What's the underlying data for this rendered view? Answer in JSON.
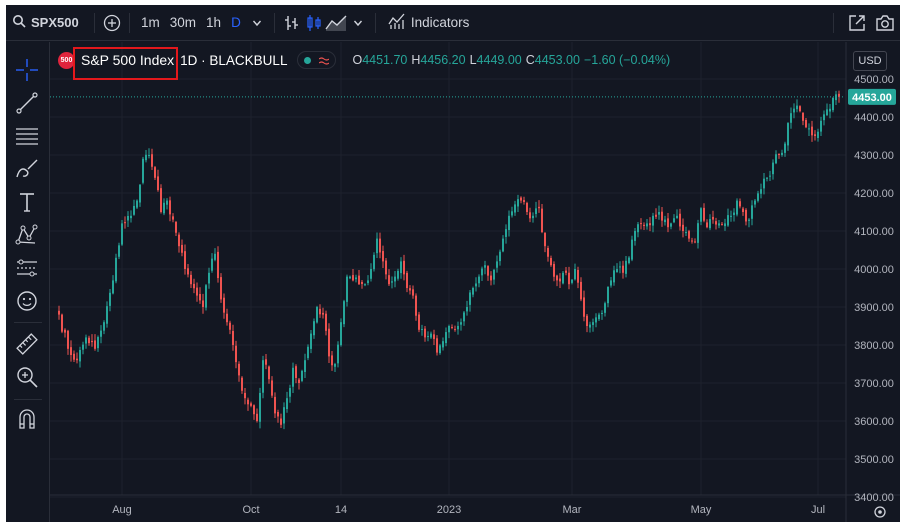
{
  "toolbar": {
    "symbol": "SPX500",
    "intervals": [
      "1m",
      "30m",
      "1h",
      "D"
    ],
    "active_interval": "D",
    "indicators_label": "Indicators",
    "icons": [
      "search-icon",
      "add-compare-icon",
      "chevron-down-icon",
      "bar-style-icon",
      "candlestick-icon",
      "area-chart-icon",
      "indicators-icon",
      "fullscreen-icon",
      "camera-icon"
    ]
  },
  "left_toolbar": {
    "tools": [
      "crosshair-icon",
      "trend-line-icon",
      "fib-lines-icon",
      "brush-icon",
      "text-icon",
      "pattern-icon",
      "forecast-icon",
      "emoji-icon",
      "ruler-icon",
      "zoom-icon",
      "magnet-icon"
    ]
  },
  "legend": {
    "logo_text": "500",
    "symbol_name": "S&P 500 Index",
    "interval_source": "1D · BLACKBULL",
    "o_label": "O",
    "o_value": "4451.70",
    "h_label": "H",
    "h_value": "4456.20",
    "l_label": "L",
    "l_value": "4449.00",
    "c_label": "C",
    "c_value": "4453.00",
    "change": "−1.60 (−0.04%)"
  },
  "price_scale": {
    "currency": "USD",
    "last_price_label": "4453.00"
  },
  "colors": {
    "background": "#131722",
    "up": "#26a69a",
    "down": "#ef5350",
    "text": "#d1d4dc",
    "accent": "#2962ff",
    "highlight": "#e3181c"
  },
  "chart_data": {
    "type": "candlestick",
    "title": "S&P 500 Index",
    "subtitle": "1D · BLACKBULL",
    "ylim": [
      3400,
      4500
    ],
    "y_ticks": [
      4500,
      4400,
      4300,
      4200,
      4100,
      4000,
      3900,
      3800,
      3700,
      3600,
      3500,
      3400
    ],
    "y_tick_labels": [
      "4500.00",
      "4400.00",
      "4300.00",
      "4200.00",
      "4100.00",
      "4000.00",
      "3900.00",
      "3800.00",
      "3700.00",
      "3600.00",
      "3500.00",
      "3400.00"
    ],
    "x_ticks": [
      {
        "label": "Aug",
        "index": 21
      },
      {
        "label": "Oct",
        "index": 64
      },
      {
        "label": "14",
        "index": 94
      },
      {
        "label": "2023",
        "index": 130
      },
      {
        "label": "Mar",
        "index": 171
      },
      {
        "label": "May",
        "index": 214
      },
      {
        "label": "Jul",
        "index": 253
      }
    ],
    "last_price": 4453.0,
    "anchors": [
      [
        0,
        3880
      ],
      [
        3,
        3790
      ],
      [
        6,
        3760
      ],
      [
        9,
        3820
      ],
      [
        12,
        3790
      ],
      [
        15,
        3860
      ],
      [
        18,
        3970
      ],
      [
        21,
        4120
      ],
      [
        24,
        4140
      ],
      [
        26,
        4180
      ],
      [
        28,
        4290
      ],
      [
        30,
        4300
      ],
      [
        32,
        4240
      ],
      [
        34,
        4150
      ],
      [
        36,
        4180
      ],
      [
        38,
        4130
      ],
      [
        40,
        4060
      ],
      [
        42,
        4000
      ],
      [
        44,
        3960
      ],
      [
        46,
        3930
      ],
      [
        48,
        3900
      ],
      [
        50,
        3990
      ],
      [
        52,
        4040
      ],
      [
        54,
        3920
      ],
      [
        56,
        3860
      ],
      [
        58,
        3800
      ],
      [
        60,
        3720
      ],
      [
        62,
        3660
      ],
      [
        64,
        3640
      ],
      [
        66,
        3600
      ],
      [
        68,
        3760
      ],
      [
        70,
        3710
      ],
      [
        72,
        3620
      ],
      [
        74,
        3590
      ],
      [
        76,
        3660
      ],
      [
        78,
        3740
      ],
      [
        80,
        3700
      ],
      [
        82,
        3760
      ],
      [
        84,
        3830
      ],
      [
        86,
        3900
      ],
      [
        88,
        3880
      ],
      [
        90,
        3770
      ],
      [
        92,
        3750
      ],
      [
        94,
        3860
      ],
      [
        96,
        3980
      ],
      [
        98,
        3970
      ],
      [
        100,
        3960
      ],
      [
        102,
        3960
      ],
      [
        104,
        4000
      ],
      [
        106,
        4080
      ],
      [
        108,
        4020
      ],
      [
        110,
        3960
      ],
      [
        112,
        3980
      ],
      [
        114,
        4020
      ],
      [
        116,
        3950
      ],
      [
        118,
        3930
      ],
      [
        120,
        3840
      ],
      [
        122,
        3820
      ],
      [
        124,
        3830
      ],
      [
        126,
        3780
      ],
      [
        128,
        3810
      ],
      [
        130,
        3850
      ],
      [
        132,
        3840
      ],
      [
        134,
        3860
      ],
      [
        136,
        3900
      ],
      [
        138,
        3950
      ],
      [
        140,
        3980
      ],
      [
        142,
        4010
      ],
      [
        144,
        3970
      ],
      [
        146,
        4020
      ],
      [
        148,
        4080
      ],
      [
        150,
        4140
      ],
      [
        152,
        4170
      ],
      [
        154,
        4180
      ],
      [
        156,
        4150
      ],
      [
        158,
        4140
      ],
      [
        160,
        4160
      ],
      [
        162,
        4060
      ],
      [
        164,
        4010
      ],
      [
        166,
        3970
      ],
      [
        168,
        3990
      ],
      [
        170,
        3960
      ],
      [
        172,
        4000
      ],
      [
        174,
        3920
      ],
      [
        176,
        3850
      ],
      [
        178,
        3860
      ],
      [
        180,
        3880
      ],
      [
        182,
        3910
      ],
      [
        184,
        3970
      ],
      [
        186,
        4000
      ],
      [
        188,
        3990
      ],
      [
        190,
        4030
      ],
      [
        192,
        4100
      ],
      [
        194,
        4120
      ],
      [
        196,
        4120
      ],
      [
        198,
        4140
      ],
      [
        200,
        4150
      ],
      [
        202,
        4130
      ],
      [
        204,
        4120
      ],
      [
        206,
        4140
      ],
      [
        208,
        4100
      ],
      [
        210,
        4080
      ],
      [
        212,
        4070
      ],
      [
        214,
        4160
      ],
      [
        216,
        4110
      ],
      [
        218,
        4130
      ],
      [
        220,
        4120
      ],
      [
        222,
        4120
      ],
      [
        224,
        4140
      ],
      [
        226,
        4180
      ],
      [
        228,
        4150
      ],
      [
        230,
        4130
      ],
      [
        232,
        4180
      ],
      [
        234,
        4210
      ],
      [
        236,
        4240
      ],
      [
        238,
        4280
      ],
      [
        240,
        4300
      ],
      [
        242,
        4330
      ],
      [
        244,
        4410
      ],
      [
        246,
        4430
      ],
      [
        248,
        4390
      ],
      [
        250,
        4370
      ],
      [
        252,
        4350
      ],
      [
        254,
        4390
      ],
      [
        256,
        4420
      ],
      [
        258,
        4450
      ],
      [
        260,
        4453
      ]
    ]
  }
}
